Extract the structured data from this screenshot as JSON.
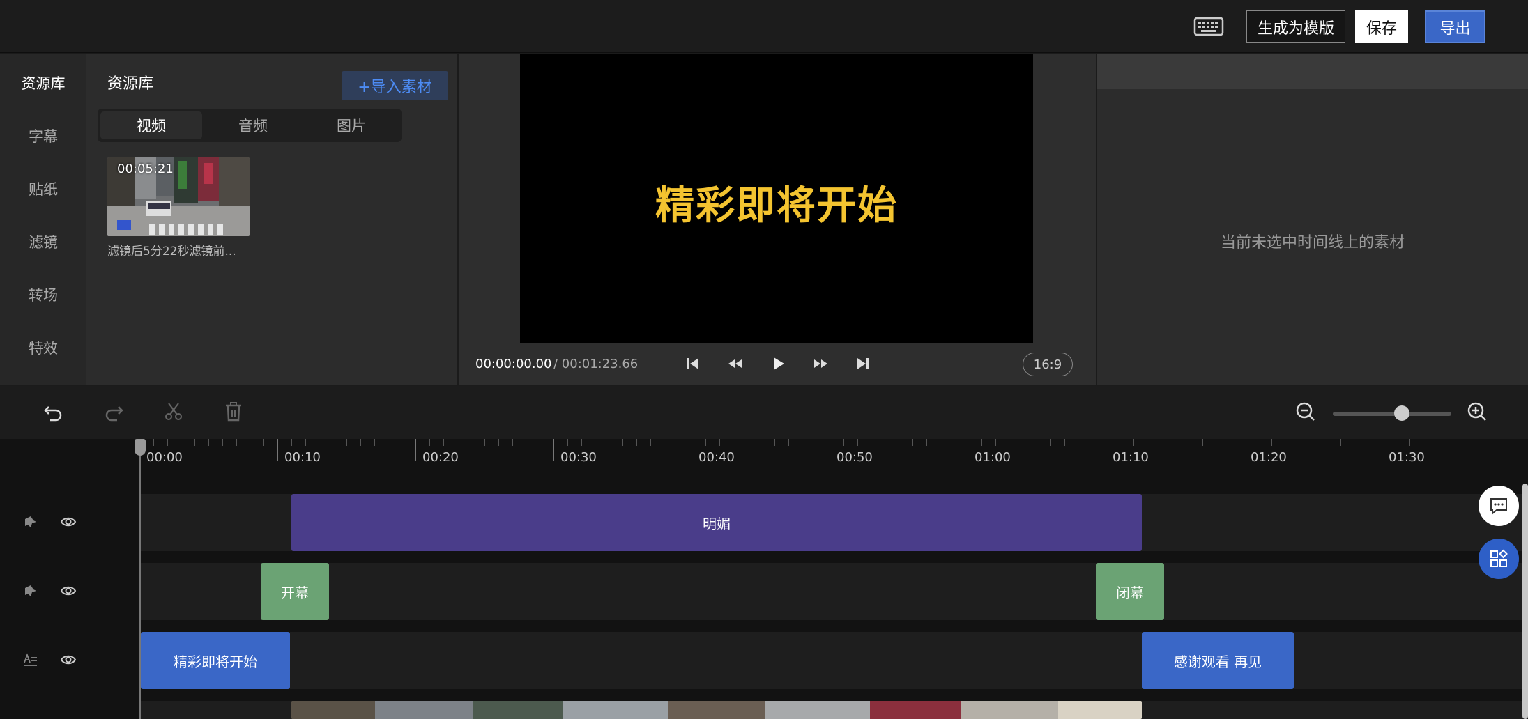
{
  "toolbar": {
    "template_label": "生成为模版",
    "save_label": "保存",
    "export_label": "导出"
  },
  "nav": {
    "items": [
      {
        "label": "资源库",
        "active": true
      },
      {
        "label": "字幕"
      },
      {
        "label": "贴纸"
      },
      {
        "label": "滤镜"
      },
      {
        "label": "转场"
      },
      {
        "label": "特效"
      }
    ]
  },
  "resources": {
    "title": "资源库",
    "import_label": "+导入素材",
    "tabs": [
      {
        "label": "视频",
        "active": true
      },
      {
        "label": "音频"
      },
      {
        "label": "图片"
      }
    ],
    "items": [
      {
        "duration": "00:05:21",
        "name": "滤镜后5分22秒滤镜前..."
      }
    ]
  },
  "preview": {
    "overlay_text": "精彩即将开始",
    "current_time": "00:00:00.00",
    "total_time": "/ 00:01:23.66",
    "aspect_ratio": "16:9"
  },
  "properties": {
    "empty_text": "当前未选中时间线上的素材"
  },
  "timeline": {
    "ruler_labels": [
      "00:00",
      "00:10",
      "00:20",
      "00:30",
      "00:40",
      "00:50",
      "01:00",
      "01:10",
      "01:20",
      "01:30"
    ],
    "tracks": [
      {
        "clips": [
          {
            "label": "明媚"
          }
        ]
      },
      {
        "clips": [
          {
            "label": "开幕"
          },
          {
            "label": "闭幕"
          }
        ]
      },
      {
        "clips": [
          {
            "label": "精彩即将开始"
          },
          {
            "label": "感谢观看 再见"
          }
        ]
      }
    ]
  },
  "colors": {
    "accent": "#3a67c7",
    "filter_clip": "#4a3d8a",
    "transition_clip": "#6ba374",
    "text_clip": "#3a67c7",
    "preview_text": "#f4c430"
  }
}
